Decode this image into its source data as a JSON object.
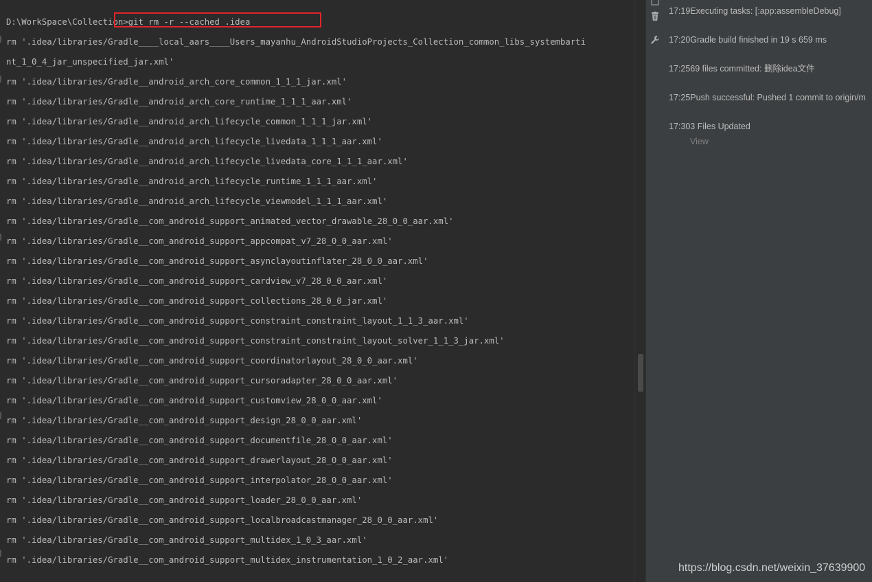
{
  "terminal": {
    "lines": [
      "D:\\WorkSpace\\Collection>git rm -r --cached .idea",
      "rm '.idea/libraries/Gradle____local_aars____Users_mayanhu_AndroidStudioProjects_Collection_common_libs_systembarti",
      "nt_1_0_4_jar_unspecified_jar.xml'",
      "rm '.idea/libraries/Gradle__android_arch_core_common_1_1_1_jar.xml'",
      "rm '.idea/libraries/Gradle__android_arch_core_runtime_1_1_1_aar.xml'",
      "rm '.idea/libraries/Gradle__android_arch_lifecycle_common_1_1_1_jar.xml'",
      "rm '.idea/libraries/Gradle__android_arch_lifecycle_livedata_1_1_1_aar.xml'",
      "rm '.idea/libraries/Gradle__android_arch_lifecycle_livedata_core_1_1_1_aar.xml'",
      "rm '.idea/libraries/Gradle__android_arch_lifecycle_runtime_1_1_1_aar.xml'",
      "rm '.idea/libraries/Gradle__android_arch_lifecycle_viewmodel_1_1_1_aar.xml'",
      "rm '.idea/libraries/Gradle__com_android_support_animated_vector_drawable_28_0_0_aar.xml'",
      "rm '.idea/libraries/Gradle__com_android_support_appcompat_v7_28_0_0_aar.xml'",
      "rm '.idea/libraries/Gradle__com_android_support_asynclayoutinflater_28_0_0_aar.xml'",
      "rm '.idea/libraries/Gradle__com_android_support_cardview_v7_28_0_0_aar.xml'",
      "rm '.idea/libraries/Gradle__com_android_support_collections_28_0_0_jar.xml'",
      "rm '.idea/libraries/Gradle__com_android_support_constraint_constraint_layout_1_1_3_aar.xml'",
      "rm '.idea/libraries/Gradle__com_android_support_constraint_constraint_layout_solver_1_1_3_jar.xml'",
      "rm '.idea/libraries/Gradle__com_android_support_coordinatorlayout_28_0_0_aar.xml'",
      "rm '.idea/libraries/Gradle__com_android_support_cursoradapter_28_0_0_aar.xml'",
      "rm '.idea/libraries/Gradle__com_android_support_customview_28_0_0_aar.xml'",
      "rm '.idea/libraries/Gradle__com_android_support_design_28_0_0_aar.xml'",
      "rm '.idea/libraries/Gradle__com_android_support_documentfile_28_0_0_aar.xml'",
      "rm '.idea/libraries/Gradle__com_android_support_drawerlayout_28_0_0_aar.xml'",
      "rm '.idea/libraries/Gradle__com_android_support_interpolator_28_0_0_aar.xml'",
      "rm '.idea/libraries/Gradle__com_android_support_loader_28_0_0_aar.xml'",
      "rm '.idea/libraries/Gradle__com_android_support_localbroadcastmanager_28_0_0_aar.xml'",
      "rm '.idea/libraries/Gradle__com_android_support_multidex_1_0_3_aar.xml'",
      "rm '.idea/libraries/Gradle__com_android_support_multidex_instrumentation_1_0_2_aar.xml'"
    ]
  },
  "event_log": {
    "entries": [
      {
        "time": "17:19",
        "text": "Executing tasks: [:app:assembleDebug]"
      },
      {
        "time": "17:20",
        "text": "Gradle build finished in 19 s 659 ms"
      },
      {
        "time": "17:25",
        "text": "69 files committed: 删除idea文件"
      },
      {
        "time": "17:25",
        "text": "Push successful: Pushed 1 commit to origin/m"
      },
      {
        "time": "17:30",
        "text": "3 Files Updated"
      }
    ],
    "view_link": "View"
  },
  "icons": {
    "tool_1": "window-icon",
    "tool_2": "trash-icon",
    "tool_3": "wrench-icon"
  },
  "colors": {
    "background": "#2b2b2b",
    "panel": "#3c3f41",
    "text": "#bbbbbb",
    "highlight": "#e0242a"
  },
  "watermark": "https://blog.csdn.net/weixin_37639900"
}
